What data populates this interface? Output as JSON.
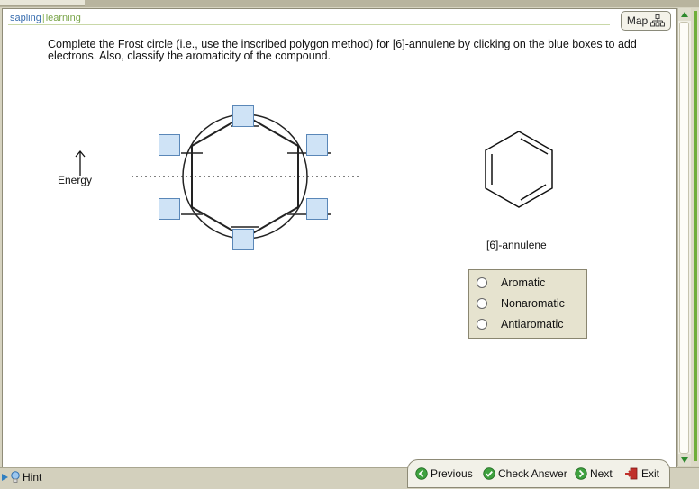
{
  "header": {
    "logo_left": "sapling",
    "logo_right": "learning",
    "map_label": "Map"
  },
  "question": {
    "instructions": "Complete the Frost circle (i.e., use the inscribed polygon method) for [6]-annulene by clicking on the blue boxes to add electrons. Also, classify the aromaticity of the compound.",
    "energy_label": "Energy",
    "molecule_label": "[6]-annulene",
    "options": [
      {
        "label": "Aromatic",
        "selected": false
      },
      {
        "label": "Nonaromatic",
        "selected": false
      },
      {
        "label": "Antiaromatic",
        "selected": false
      }
    ]
  },
  "footer": {
    "hint_label": "Hint",
    "previous_label": "Previous",
    "check_label": "Check Answer",
    "next_label": "Next",
    "exit_label": "Exit"
  },
  "colors": {
    "accent_green": "#6fae3a",
    "orbital_fill": "#cfe3f6",
    "orbital_border": "#5a87b8",
    "logo_blue": "#3a6fb0"
  },
  "icons": [
    "hierarchy-icon",
    "lightbulb-icon",
    "previous-arrow-icon",
    "check-icon",
    "next-arrow-icon",
    "exit-icon",
    "scroll-up-icon",
    "scroll-down-icon"
  ]
}
